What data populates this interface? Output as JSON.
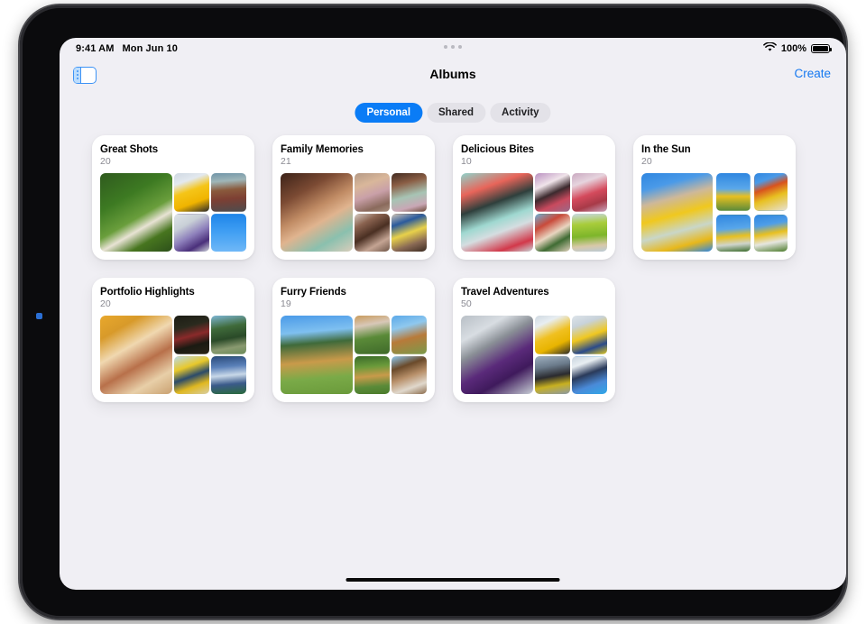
{
  "status_bar": {
    "time": "9:41 AM",
    "date": "Mon Jun 10",
    "battery_percent": "100%",
    "wifi_icon": "wifi-icon",
    "battery_icon": "battery-full-icon"
  },
  "nav_bar": {
    "sidebar_toggle_icon": "sidebar-toggle-icon",
    "title": "Albums",
    "create_label": "Create"
  },
  "segmented_control": {
    "selected": "Personal",
    "accent_color": "#0a7cf6",
    "options": [
      {
        "label": "Personal",
        "selected": true
      },
      {
        "label": "Shared",
        "selected": false
      },
      {
        "label": "Activity",
        "selected": false
      }
    ]
  },
  "albums": [
    {
      "title": "Great Shots",
      "count": "20",
      "style": "tight",
      "photos": {
        "hero": "linear-gradient(150deg,#2f5a1e 0%,#3d7a22 32%,#6a9e3c 55%,#e8e3d4 66%,#47751f 80%,#2c4f1a 100%)",
        "small": [
          "linear-gradient(160deg,#cfd8e2 0%,#e3e9ef 24%,#f5c518 46%,#f0b400 72%,#2a2a2c 100%)",
          "linear-gradient(175deg,#6e94a8 0%,#9fb6b8 22%,#8a5a3c 44%,#7d3f33 66%,#4c4c4e 100%)",
          "linear-gradient(150deg,#dfe4e8 0%,#c8cfd6 30%,#8d7fbb 55%,#4a2f7a 78%,#cfd5da 100%)",
          "linear-gradient(180deg,#1f84e8 0%,#3a9bf2 40%,#6fb8f7 100%)"
        ]
      }
    },
    {
      "title": "Family Memories",
      "count": "21",
      "style": "tight",
      "photos": {
        "hero": "linear-gradient(150deg,#3c2218 0%,#7b4a33 26%,#c08b64 46%,#e0b48f 60%,#8ac0ae 80%,#d9cdbb 100%)",
        "small": [
          "linear-gradient(160deg,#b59a86 0%,#d9b79a 30%,#c9a0a8 55%,#8a6a5c 82%,#a88f7e 100%)",
          "linear-gradient(165deg,#402a20 0%,#8a5e45 28%,#a7c4b4 58%,#c9a7b5 82%,#6d4a38 100%)",
          "linear-gradient(150deg,#d5cac0 0%,#8a6350 25%,#4a2f22 50%,#c4a493 75%,#6d5446 100%)",
          "linear-gradient(160deg,#cfc4b7 0%,#2a5a9c 25%,#e8d14a 50%,#8a6a55 75%,#3a2a20 100%)"
        ]
      }
    },
    {
      "title": "Delicious Bites",
      "count": "10",
      "style": "tight",
      "photos": {
        "hero": "linear-gradient(160deg,#8fd3cb 0%,#e8655a 22%,#2f3f3c 40%,#9fd8d0 58%,#d5dde0 70%,#d2384a 88%,#c8d4d6 100%)",
        "small": [
          "linear-gradient(155deg,#b98fc0 0%,#f0e4ea 30%,#3c2a2e 52%,#c94a5e 74%,#9a6a8a 100%)",
          "linear-gradient(160deg,#c9a8c0 0%,#e6d4de 26%,#d44a5c 54%,#a83a48 76%,#caa5bd 100%)",
          "linear-gradient(150deg,#6db0d8 0%,#c94a3a 28%,#e8d5c0 52%,#3f6b33 72%,#dfd0bb 100%)",
          "linear-gradient(175deg,#c8d8e4 0%,#a8cc3a 28%,#7db52a 58%,#d8c8a8 82%,#b9cad6 100%)"
        ]
      }
    },
    {
      "title": "In the Sun",
      "count": "20",
      "style": "spaced",
      "photos": {
        "hero": "linear-gradient(165deg,#2f86e0 0%,#4a9ae8 18%,#cdb89a 34%,#f0c81e 52%,#c9d6c8 70%,#e8b81a 86%,#2f86e0 100%)",
        "small": [
          "linear-gradient(180deg,#2f86e0 0%,#5aa8ea 42%,#e8c020 62%,#5a8a3a 100%)",
          "linear-gradient(160deg,#2f86e0 0%,#4a9ae8 22%,#d8521e 40%,#e8c020 62%,#e6e2d8 100%)",
          "linear-gradient(175deg,#2f86e0 0%,#58a6ea 38%,#e8c020 58%,#cfd4cc 78%,#3a6a2a 100%)",
          "linear-gradient(170deg,#2f86e0 0%,#4f9ee8 28%,#e8c020 50%,#e6e6e0 72%,#4a7a2a 100%)"
        ]
      }
    },
    {
      "title": "Portfolio Highlights",
      "count": "20",
      "style": "tight",
      "photos": {
        "hero": "linear-gradient(150deg,#e8a82c 0%,#d89a2a 20%,#f0d8b0 40%,#b8704a 60%,#e8cfa8 80%,#c9a070 100%)",
        "small": [
          "linear-gradient(165deg,#1c1c14 0%,#2a2a1e 30%,#8a2a2a 52%,#1a1a12 74%,#2a2418 100%)",
          "linear-gradient(170deg,#7fb8d8 0%,#3f6a3a 32%,#2a4a28 58%,#8a9a70 80%,#6a8a58 100%)",
          "linear-gradient(160deg,#b8d8ea 0%,#e8c82a 30%,#2a4a6a 52%,#e0b820 74%,#d8cfa8 100%)",
          "linear-gradient(175deg,#2a4a7a 0%,#5a80b8 28%,#c8d8e8 50%,#3a5a8a 72%,#2a6a3a 100%)"
        ]
      }
    },
    {
      "title": "Furry Friends",
      "count": "19",
      "style": "tight",
      "photos": {
        "hero": "linear-gradient(175deg,#4a9ae8 0%,#7fc0f0 22%,#3f6a3a 36%,#c99a4a 58%,#7aaa48 78%,#6a9a3a 100%)",
        "small": [
          "linear-gradient(170deg,#c89a5a 0%,#d8c8b8 26%,#5a8a38 56%,#3f6a2a 100%)",
          "linear-gradient(165deg,#5aa8e8 0%,#8fc8ee 30%,#b87a3a 58%,#7a9a4a 100%)",
          "linear-gradient(175deg,#3a6a2a 0%,#6a9a3a 28%,#c89a4a 52%,#5a8a38 78%,#4a7a2a 100%)",
          "linear-gradient(160deg,#8fc8ee 0%,#6a4a2a 28%,#b8906a 52%,#e0d8cc 76%,#8a6a4a 100%)"
        ]
      }
    },
    {
      "title": "Travel Adventures",
      "count": "50",
      "style": "tight",
      "photos": {
        "hero": "linear-gradient(150deg,#b8bfc6 0%,#d8dde2 22%,#8a8f96 38%,#5a2a7a 58%,#3f1a5c 74%,#c8cfd6 100%)",
        "small": [
          "linear-gradient(155deg,#cfd8e0 0%,#e8eef2 22%,#f0c020 50%,#e8b400 72%,#2a2a2c 100%)",
          "linear-gradient(160deg,#dde4ea 0%,#c8d2da 24%,#f0c820 52%,#2a4a8a 78%,#e0c820 100%)",
          "linear-gradient(170deg,#9fb0c0 0%,#6a7a8a 28%,#2a2a2e 52%,#c8b020 74%,#8a98a8 100%)",
          "linear-gradient(160deg,#c8d4de 0%,#e8eef2 22%,#2a3a5a 46%,#4a8ad8 72%,#2fa8e8 100%)"
        ]
      }
    }
  ],
  "home_indicator": "home-indicator"
}
